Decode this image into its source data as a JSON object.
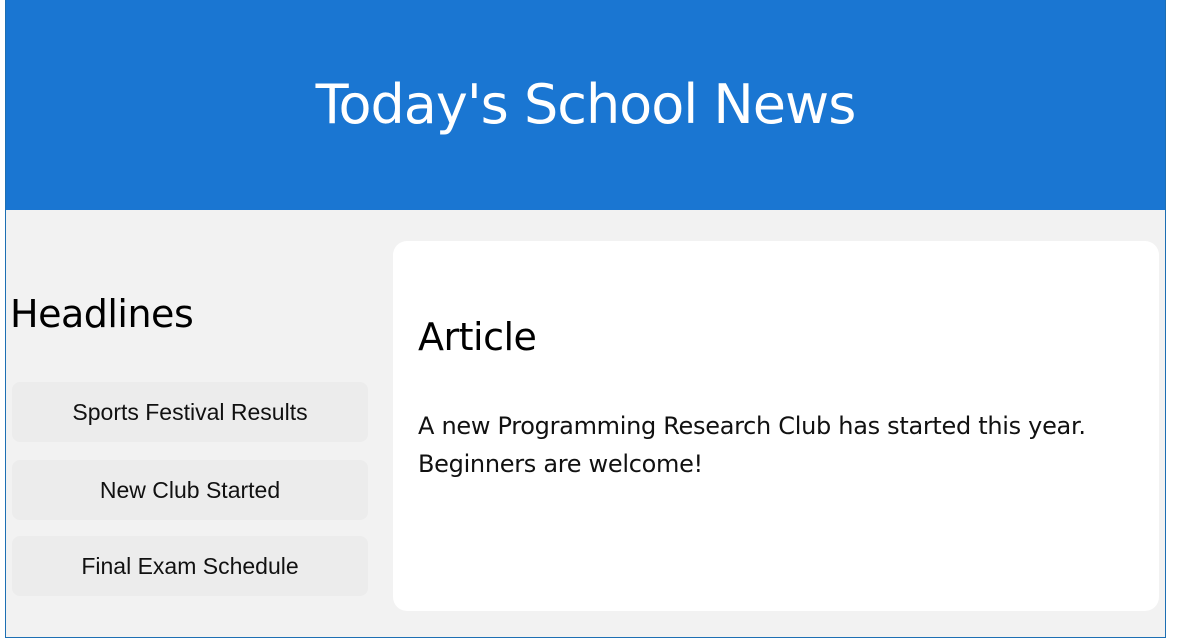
{
  "header": {
    "title": "Today's School News"
  },
  "sidebar": {
    "heading": "Headlines",
    "items": [
      {
        "label": "Sports Festival Results"
      },
      {
        "label": "New Club Started"
      },
      {
        "label": "Final Exam Schedule"
      }
    ]
  },
  "article": {
    "heading": "Article",
    "body": "A new Programming Research Club has started this year. Beginners are welcome!"
  },
  "colors": {
    "header_background": "#1a76d2",
    "page_background": "#f2f2f2",
    "button_background": "#ececec",
    "card_background": "#ffffff"
  }
}
